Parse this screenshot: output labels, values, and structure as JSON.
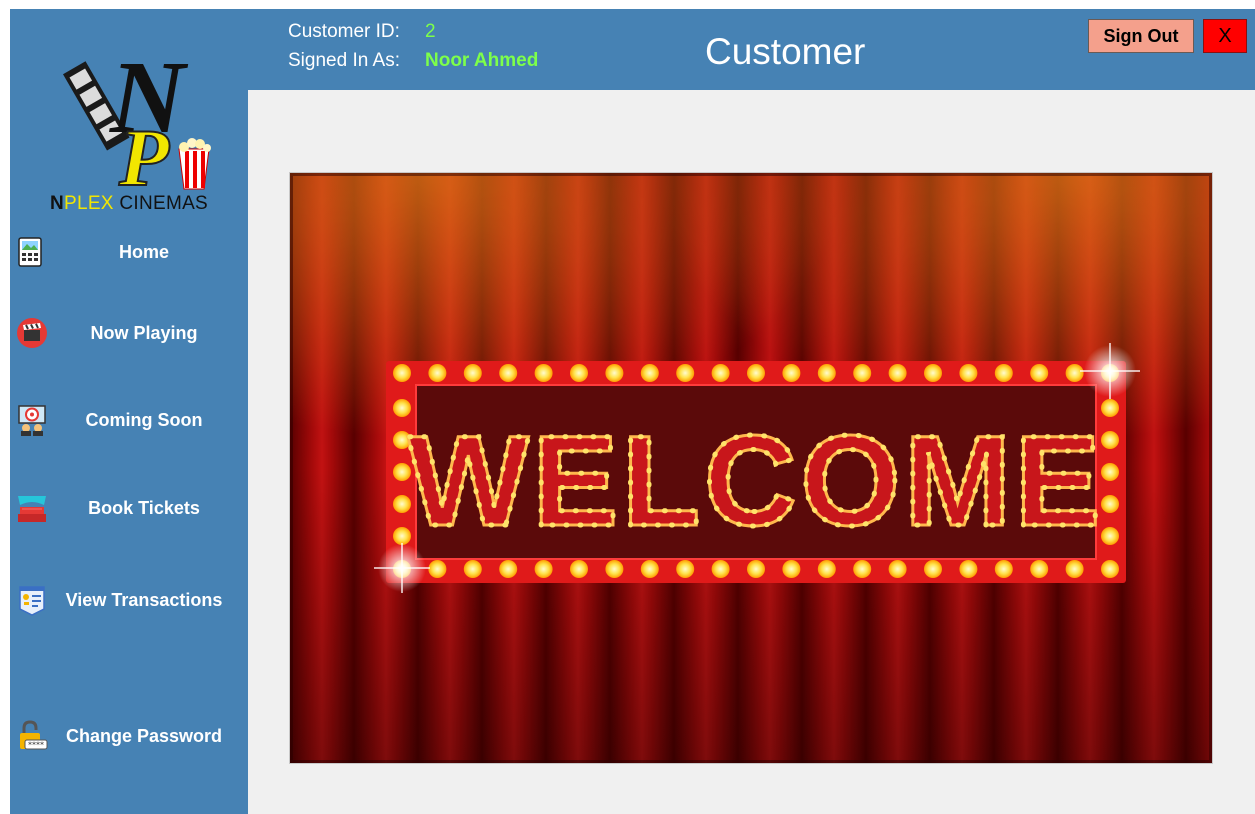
{
  "header": {
    "customer_id_label": "Customer ID:",
    "customer_id": "2",
    "signed_in_label": "Signed In As:",
    "user_name": "Noor Ahmed",
    "title": "Customer",
    "signout_label": "Sign Out",
    "close_label": "X"
  },
  "brand": {
    "logo_letters": "NP",
    "name_n": "N",
    "name_plex": "PLEX",
    "name_cinemas": " CINEMAS"
  },
  "sidebar": {
    "items": [
      {
        "label": "Home",
        "icon": "home-icon"
      },
      {
        "label": "Now Playing",
        "icon": "clapperboard-icon"
      },
      {
        "label": "Coming Soon",
        "icon": "coming-soon-icon"
      },
      {
        "label": "Book Tickets",
        "icon": "theater-seats-icon"
      },
      {
        "label": "View Transactions",
        "icon": "transactions-icon"
      },
      {
        "label": "Change Password",
        "icon": "lock-icon"
      }
    ]
  },
  "main": {
    "welcome_text": "WELCOME"
  },
  "colors": {
    "accent": "#4682b4",
    "highlight": "#7dff4a",
    "signout": "#f4a08c",
    "close": "#ff0000",
    "brand_yellow": "#f2e600"
  }
}
